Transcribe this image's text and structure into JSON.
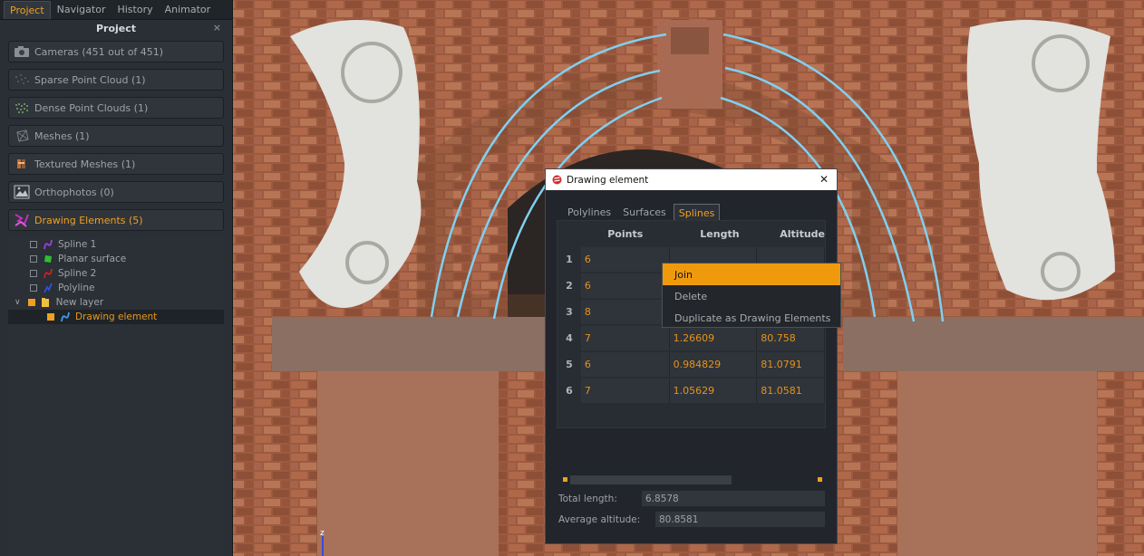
{
  "panel": {
    "tabs": [
      "Project",
      "Navigator",
      "History",
      "Animator"
    ],
    "title": "Project",
    "close": "×",
    "categories": [
      {
        "label": "Cameras (451 out of 451)",
        "icon": "camera-icon"
      },
      {
        "label": "Sparse Point Cloud (1)",
        "icon": "sparse-cloud-icon"
      },
      {
        "label": "Dense Point Clouds (1)",
        "icon": "dense-cloud-icon"
      },
      {
        "label": "Meshes (1)",
        "icon": "mesh-icon"
      },
      {
        "label": "Textured Meshes (1)",
        "icon": "textured-mesh-icon"
      },
      {
        "label": "Orthophotos (0)",
        "icon": "orthophoto-icon"
      },
      {
        "label": "Drawing Elements (5)",
        "icon": "drawing-elements-icon"
      }
    ],
    "tree": [
      {
        "label": "Spline 1",
        "icon": "spline-icon"
      },
      {
        "label": "Planar surface",
        "icon": "surface-icon"
      },
      {
        "label": "Spline 2",
        "icon": "spline-icon"
      },
      {
        "label": "Polyline",
        "icon": "polyline-icon"
      },
      {
        "label": "New layer",
        "icon": "folder-icon"
      },
      {
        "label": "Drawing element",
        "icon": "spline-icon"
      }
    ]
  },
  "dialog": {
    "title": "Drawing element",
    "close": "✕",
    "tabs": [
      "Polylines",
      "Surfaces",
      "Splines"
    ],
    "active_tab": "Splines",
    "columns": [
      "Points",
      "Length",
      "Altitude"
    ],
    "rows": [
      {
        "n": "1",
        "points": "6",
        "length": "",
        "altitude": ""
      },
      {
        "n": "2",
        "points": "6",
        "length": "",
        "altitude": ""
      },
      {
        "n": "3",
        "points": "8",
        "length": "",
        "altitude": ""
      },
      {
        "n": "4",
        "points": "7",
        "length": "1.26609",
        "altitude": "80.758"
      },
      {
        "n": "5",
        "points": "6",
        "length": "0.984829",
        "altitude": "81.0791"
      },
      {
        "n": "6",
        "points": "7",
        "length": "1.05629",
        "altitude": "81.0581"
      }
    ],
    "total_length_label": "Total length:",
    "total_length": "6.8578",
    "avg_altitude_label": "Average altitude:",
    "avg_altitude": "80.8581"
  },
  "context_menu": {
    "items": [
      "Join",
      "Delete",
      "Duplicate as Drawing Elements"
    ]
  },
  "colors": {
    "accent": "#f0a020",
    "spline": "#7fd0f2"
  },
  "axis_label": "z"
}
